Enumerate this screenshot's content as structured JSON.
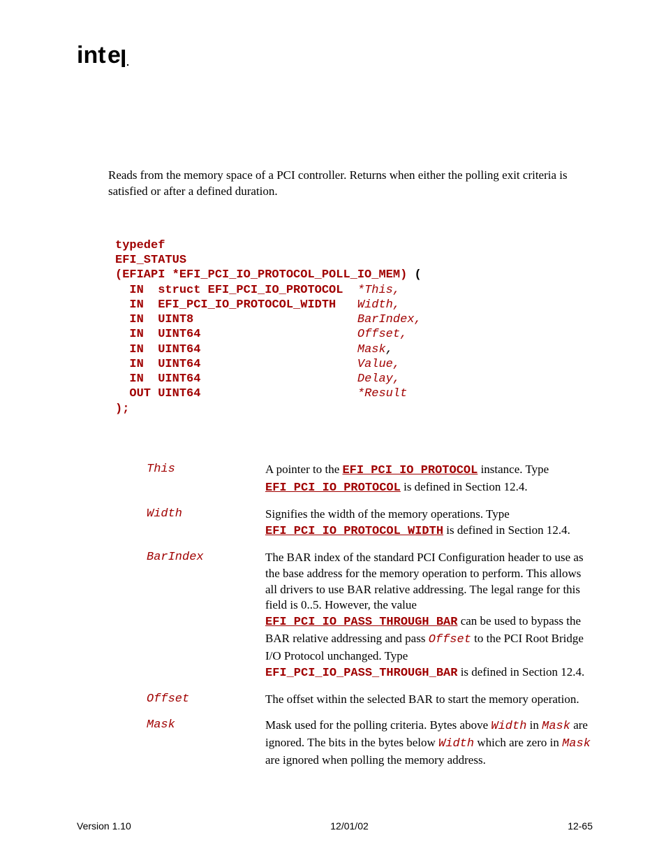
{
  "logo_text": "intel",
  "intro": "Reads from the memory space of a PCI controller.  Returns when either the polling exit criteria is satisfied or after a defined duration.",
  "prototype": {
    "l1": "typedef",
    "l2": "EFI_STATUS",
    "l3a": "(EFIAPI *EFI_PCI_IO_PROTOCOL_POLL_IO_MEM)",
    "l3b": " (",
    "rows": [
      {
        "dir": "  IN  ",
        "type": "struct EFI_PCI_IO_PROTOCOL  ",
        "star": "*",
        "name": "This",
        "comma": ","
      },
      {
        "dir": "  IN  ",
        "type": "EFI_PCI_IO_PROTOCOL_WIDTH   ",
        "star": "",
        "name": "Width",
        "comma": ","
      },
      {
        "dir": "  IN  ",
        "type": "UINT8                       ",
        "star": "",
        "name": "BarIndex",
        "comma": ","
      },
      {
        "dir": "  IN  ",
        "type": "UINT64                      ",
        "star": "",
        "name": "Offset",
        "comma": ","
      },
      {
        "dir": "  IN  ",
        "type": "UINT64                      ",
        "star": "",
        "name": "Mask",
        "comma": ",",
        "black_comma": true
      },
      {
        "dir": "  IN  ",
        "type": "UINT64                      ",
        "star": "",
        "name": "Value",
        "comma": ","
      },
      {
        "dir": "  IN  ",
        "type": "UINT64                      ",
        "star": "",
        "name": "Delay",
        "comma": ","
      },
      {
        "dir": "  OUT ",
        "type": "UINT64                      ",
        "star": "*",
        "name": "Result",
        "comma": ""
      }
    ],
    "close": ");"
  },
  "params": {
    "this": {
      "name": "This",
      "t1": "A pointer to the ",
      "c1": "EFI_PCI_IO_PROTOCOL",
      "t2": " instance.  Type ",
      "c2": "EFI_PCI_IO_PROTOCOL",
      "t3": " is defined in Section 12.4."
    },
    "width": {
      "name": "Width",
      "t1": "Signifies the width of the memory operations.  Type ",
      "c1": "EFI_PCI_IO_PROTOCOL_WIDTH",
      "t2": " is defined in Section 12.4."
    },
    "barindex": {
      "name": "BarIndex",
      "t1": "The BAR index of the standard PCI Configuration header to use as the base address for the memory operation to perform.  This allows all drivers to use BAR relative addressing.  The legal range for this field is 0..5.  However, the value ",
      "c1": "EFI_PCI_IO_PASS_THROUGH_BAR",
      "t2": " can be used to bypass the BAR relative addressing and pass ",
      "i1": "Offset",
      "t3": " to the PCI Root Bridge I/O Protocol unchanged.  Type ",
      "c2": "EFI_PCI_IO_PASS_THROUGH_BAR",
      "t4": " is defined in Section 12.4."
    },
    "offset": {
      "name": "Offset",
      "t1": "The offset within the selected BAR to start the memory operation."
    },
    "mask": {
      "name": "Mask",
      "t1": "Mask used for the polling criteria.  Bytes above ",
      "i1": "Width",
      "t2": " in ",
      "i2": "Mask",
      "t3": " are ignored.  The bits in the bytes below ",
      "i3": "Width",
      "t4": " which are zero in ",
      "i4": "Mask",
      "t5": " are ignored when polling the memory address."
    }
  },
  "footer": {
    "left": "Version 1.10",
    "center": "12/01/02",
    "right": "12-65"
  }
}
